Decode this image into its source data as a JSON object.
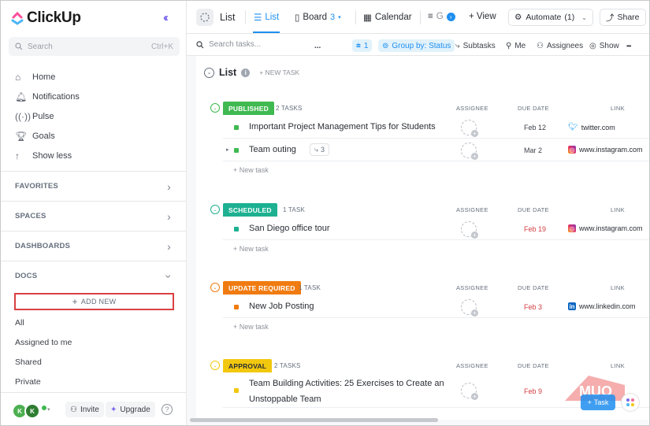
{
  "app": {
    "name": "ClickUp"
  },
  "sidebar": {
    "search_placeholder": "Search",
    "search_shortcut": "Ctrl+K",
    "nav": [
      {
        "label": "Home",
        "icon": "home-icon"
      },
      {
        "label": "Notifications",
        "icon": "bell-icon"
      },
      {
        "label": "Pulse",
        "icon": "pulse-icon"
      },
      {
        "label": "Goals",
        "icon": "trophy-icon"
      },
      {
        "label": "Show less",
        "icon": "arrow-up-icon"
      }
    ],
    "sections": {
      "favorites": "FAVORITES",
      "spaces": "SPACES",
      "dashboards": "DASHBOARDS",
      "docs": "DOCS"
    },
    "add_new": "ADD NEW",
    "docs_items": [
      "All",
      "Assigned to me",
      "Shared",
      "Private"
    ],
    "footer": {
      "avatar1": "K",
      "avatar2": "K",
      "invite": "Invite",
      "upgrade": "Upgrade",
      "help": "?"
    }
  },
  "topbar": {
    "title": "List",
    "tabs": {
      "list": "List",
      "board": "Board",
      "board_count": "3",
      "calendar": "Calendar",
      "gantt": "G",
      "view": "+ View"
    },
    "automate": "Automate",
    "automate_count": "(1)",
    "share": "Share"
  },
  "toolbar": {
    "search_placeholder": "Search tasks...",
    "more": "...",
    "filter_count": "1",
    "group_by": "Group by: Status",
    "subtasks": "Subtasks",
    "me": "Me",
    "assignees": "Assignees",
    "show": "Show",
    "overflow": "•••"
  },
  "list": {
    "title": "List",
    "new_task": "+ NEW TASK",
    "columns": {
      "assignee": "ASSIGNEE",
      "due": "DUE DATE",
      "link": "LINK"
    },
    "add_task": "+ New task",
    "groups": [
      {
        "status": "PUBLISHED",
        "color": "#3fb950",
        "count": "2 TASKS",
        "tasks": [
          {
            "name": "Important Project Management Tips for Students",
            "due": "Feb 12",
            "due_red": false,
            "link": "twitter.com",
            "link_icon": "twitter-icon"
          },
          {
            "name": "Team outing",
            "subtasks": "3",
            "due": "Mar 2",
            "due_red": false,
            "link": "www.instagram.com",
            "link_icon": "instagram-icon"
          }
        ]
      },
      {
        "status": "SCHEDULED",
        "color": "#1db191",
        "count": "1 TASK",
        "tasks": [
          {
            "name": "San Diego office tour",
            "due": "Feb 19",
            "due_red": true,
            "link": "www.instagram.com",
            "link_icon": "instagram-icon"
          }
        ]
      },
      {
        "status": "UPDATE REQUIRED",
        "color": "#f07b10",
        "count": "1 TASK",
        "tasks": [
          {
            "name": "New Job Posting",
            "due": "Feb 3",
            "due_red": true,
            "link": "www.linkedin.com",
            "link_icon": "linkedin-icon"
          }
        ]
      },
      {
        "status": "APPROVAL",
        "color": "#f2c80f",
        "count": "2 TASKS",
        "tasks": [
          {
            "name": "Team Building Activities: 25 Exercises to Create an",
            "name2": "Unstoppable Team",
            "due": "Feb 9",
            "due_red": true
          }
        ]
      }
    ]
  },
  "fab": {
    "task": "Task"
  },
  "watermark": "MUO"
}
